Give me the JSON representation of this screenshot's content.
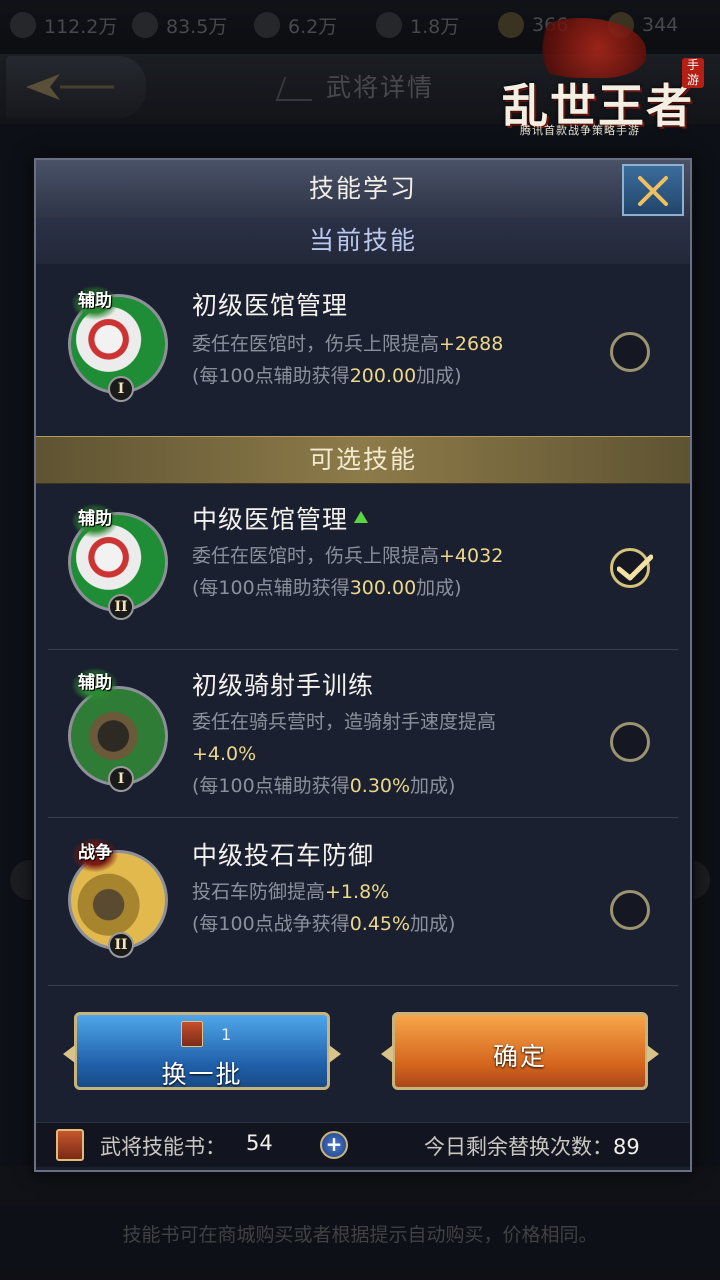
{
  "resources": [
    {
      "icon": "wood-icon",
      "value": "112.2万"
    },
    {
      "icon": "iron-icon",
      "value": "83.5万"
    },
    {
      "icon": "stone-icon",
      "value": "6.2万"
    },
    {
      "icon": "crystal-icon",
      "value": "1.8万"
    },
    {
      "icon": "coin-icon",
      "value": "366"
    },
    {
      "icon": "ingot-icon",
      "value": "344"
    }
  ],
  "background": {
    "page_title": "武将详情",
    "footer_tip": "技能书可在商城购买或者根据提示自动购买，价格相同。"
  },
  "logo": {
    "title": "乱世王者",
    "subtitle": "腾讯首款战争策略手游",
    "badge": "手游"
  },
  "dialog": {
    "title": "技能学习",
    "section_current": "当前技能",
    "section_optional": "可选技能",
    "current_skill": {
      "tag": "辅助",
      "level": "I",
      "name": "初级医馆管理",
      "desc_prefix": "委任在医馆时，伤兵上限提高",
      "desc_value": "+2688",
      "note_prefix": "(每100点辅助获得",
      "note_value": "200.00",
      "note_suffix": "加成)",
      "selected": false
    },
    "options": [
      {
        "tag": "辅助",
        "level": "II",
        "name": "中级医馆管理",
        "upgrade_arrow": true,
        "desc_prefix": "委任在医馆时，伤兵上限提高",
        "desc_value": "+4032",
        "note_prefix": "(每100点辅助获得",
        "note_value": "300.00",
        "note_suffix": "加成)",
        "selected": true
      },
      {
        "tag": "辅助",
        "level": "I",
        "name": "初级骑射手训练",
        "desc_prefix": "委任在骑兵营时，造骑射手速度提高",
        "desc_value": "+4.0%",
        "note_prefix": "(每100点辅助获得",
        "note_value": "0.30%",
        "note_suffix": "加成)",
        "selected": false
      },
      {
        "tag": "战争",
        "level": "II",
        "name": "中级投石车防御",
        "desc_prefix": "投石车防御提高",
        "desc_value": "+1.8%",
        "note_prefix": "(每100点战争获得",
        "note_value": "0.45%",
        "note_suffix": "加成)",
        "selected": false
      }
    ],
    "refresh_button": {
      "label": "换一批",
      "cost": "1"
    },
    "confirm_button": {
      "label": "确定"
    },
    "footer": {
      "book_label": "武将技能书：",
      "book_count": "54",
      "replace_label": "今日剩余替换次数：",
      "replace_count": "89"
    }
  },
  "colors": {
    "highlight": "#ecd78a",
    "section_gold": "#8d7b49",
    "refresh_blue": "#1f5fa8",
    "confirm_orange": "#d4641c"
  }
}
